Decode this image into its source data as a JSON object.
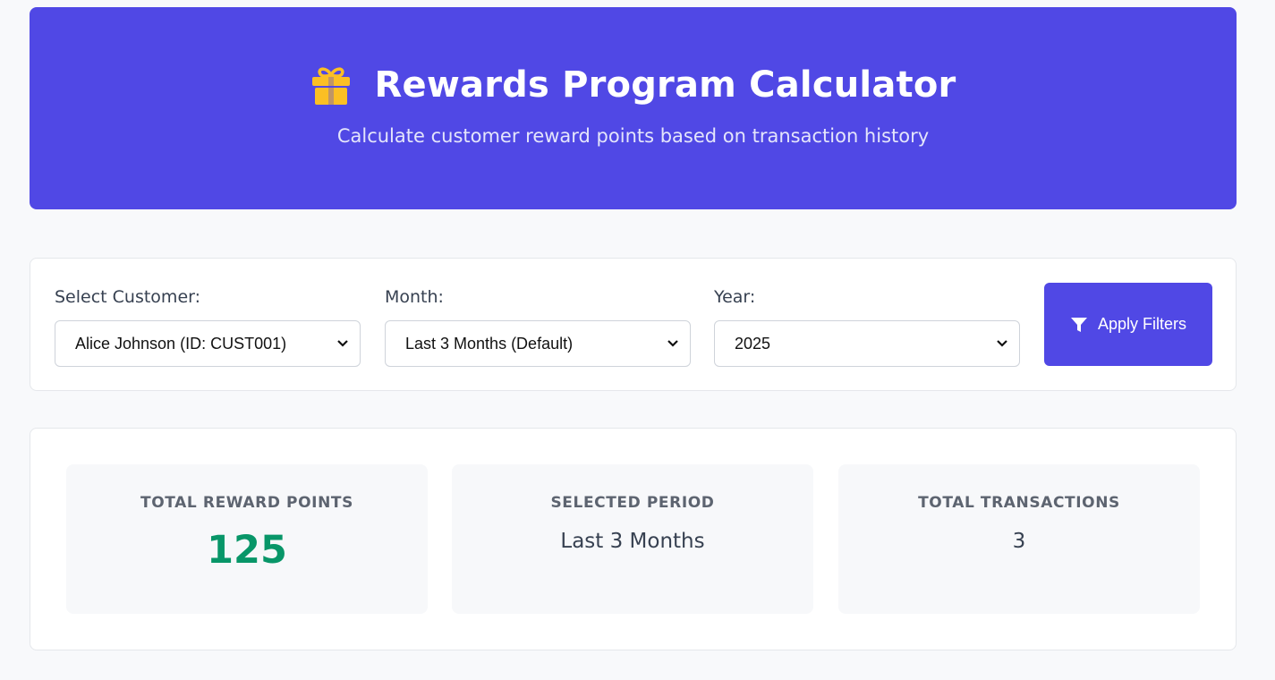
{
  "header": {
    "title": "Rewards Program Calculator",
    "subtitle": "Calculate customer reward points based on transaction history",
    "icon": "gift-icon",
    "background_color": "#5048e5"
  },
  "filters": {
    "customer": {
      "label": "Select Customer:",
      "value": "Alice Johnson (ID: CUST001)"
    },
    "month": {
      "label": "Month:",
      "value": "Last 3 Months (Default)"
    },
    "year": {
      "label": "Year:",
      "value": "2025"
    },
    "apply_button": {
      "label": "Apply Filters",
      "icon": "filter-icon"
    }
  },
  "summary": {
    "total_points": {
      "label": "TOTAL REWARD POINTS",
      "value": "125",
      "color": "#089668"
    },
    "selected_period": {
      "label": "SELECTED PERIOD",
      "value": "Last 3 Months"
    },
    "total_transactions": {
      "label": "TOTAL TRANSACTIONS",
      "value": "3"
    }
  }
}
